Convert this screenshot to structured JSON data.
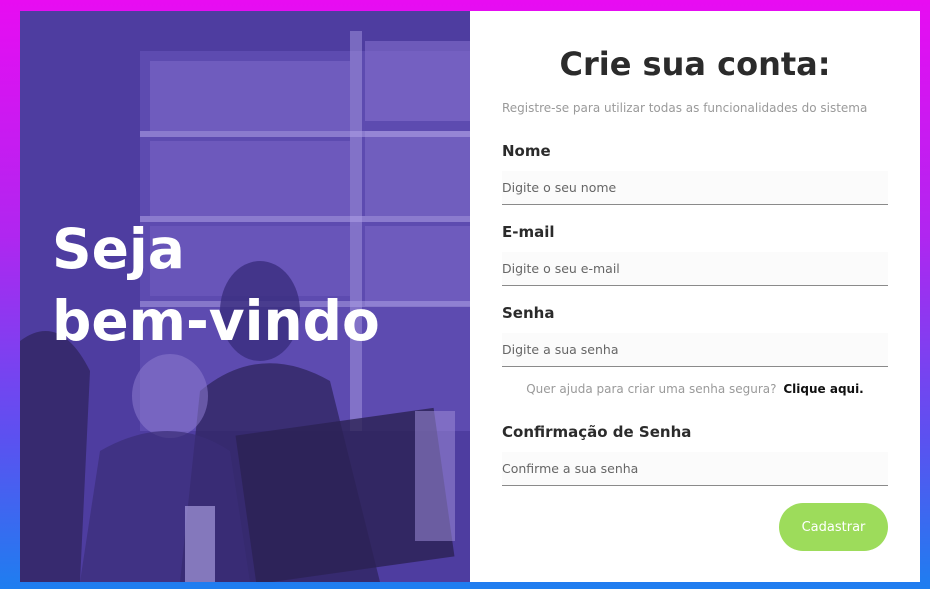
{
  "hero": {
    "line1": "Seja",
    "line2": "bem-vindo"
  },
  "form": {
    "title": "Crie sua conta:",
    "subtitle": "Registre-se para utilizar todas as funcionalidades do sistema",
    "fields": [
      {
        "label": "Nome",
        "placeholder": "Digite o seu nome"
      },
      {
        "label": "E-mail",
        "placeholder": "Digite o seu e-mail"
      },
      {
        "label": "Senha",
        "placeholder": "Digite a sua senha"
      },
      {
        "label": "Confirmação de Senha",
        "placeholder": "Confirme a sua senha"
      }
    ],
    "help_text": "Quer ajuda para criar uma senha segura?",
    "help_link": "Clique aqui.",
    "submit_label": "Cadastrar"
  },
  "colors": {
    "overlay": "#5c47b2",
    "button": "#9ddc5b",
    "text": "#2b2b2b"
  }
}
